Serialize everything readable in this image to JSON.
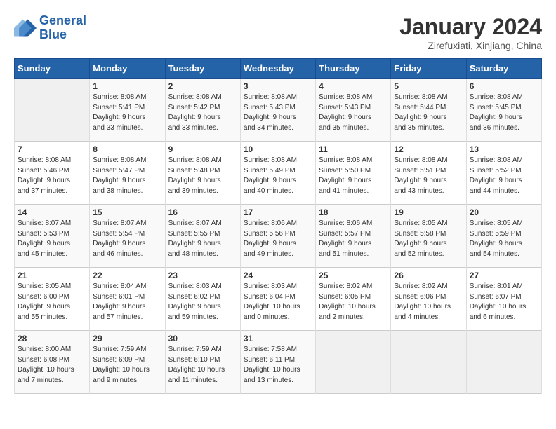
{
  "logo": {
    "line1": "General",
    "line2": "Blue"
  },
  "title": "January 2024",
  "location": "Zirefuxiati, Xinjiang, China",
  "days_header": [
    "Sunday",
    "Monday",
    "Tuesday",
    "Wednesday",
    "Thursday",
    "Friday",
    "Saturday"
  ],
  "weeks": [
    [
      {
        "day": "",
        "info": ""
      },
      {
        "day": "1",
        "info": "Sunrise: 8:08 AM\nSunset: 5:41 PM\nDaylight: 9 hours\nand 33 minutes."
      },
      {
        "day": "2",
        "info": "Sunrise: 8:08 AM\nSunset: 5:42 PM\nDaylight: 9 hours\nand 33 minutes."
      },
      {
        "day": "3",
        "info": "Sunrise: 8:08 AM\nSunset: 5:43 PM\nDaylight: 9 hours\nand 34 minutes."
      },
      {
        "day": "4",
        "info": "Sunrise: 8:08 AM\nSunset: 5:43 PM\nDaylight: 9 hours\nand 35 minutes."
      },
      {
        "day": "5",
        "info": "Sunrise: 8:08 AM\nSunset: 5:44 PM\nDaylight: 9 hours\nand 35 minutes."
      },
      {
        "day": "6",
        "info": "Sunrise: 8:08 AM\nSunset: 5:45 PM\nDaylight: 9 hours\nand 36 minutes."
      }
    ],
    [
      {
        "day": "7",
        "info": "Sunrise: 8:08 AM\nSunset: 5:46 PM\nDaylight: 9 hours\nand 37 minutes."
      },
      {
        "day": "8",
        "info": "Sunrise: 8:08 AM\nSunset: 5:47 PM\nDaylight: 9 hours\nand 38 minutes."
      },
      {
        "day": "9",
        "info": "Sunrise: 8:08 AM\nSunset: 5:48 PM\nDaylight: 9 hours\nand 39 minutes."
      },
      {
        "day": "10",
        "info": "Sunrise: 8:08 AM\nSunset: 5:49 PM\nDaylight: 9 hours\nand 40 minutes."
      },
      {
        "day": "11",
        "info": "Sunrise: 8:08 AM\nSunset: 5:50 PM\nDaylight: 9 hours\nand 41 minutes."
      },
      {
        "day": "12",
        "info": "Sunrise: 8:08 AM\nSunset: 5:51 PM\nDaylight: 9 hours\nand 43 minutes."
      },
      {
        "day": "13",
        "info": "Sunrise: 8:08 AM\nSunset: 5:52 PM\nDaylight: 9 hours\nand 44 minutes."
      }
    ],
    [
      {
        "day": "14",
        "info": "Sunrise: 8:07 AM\nSunset: 5:53 PM\nDaylight: 9 hours\nand 45 minutes."
      },
      {
        "day": "15",
        "info": "Sunrise: 8:07 AM\nSunset: 5:54 PM\nDaylight: 9 hours\nand 46 minutes."
      },
      {
        "day": "16",
        "info": "Sunrise: 8:07 AM\nSunset: 5:55 PM\nDaylight: 9 hours\nand 48 minutes."
      },
      {
        "day": "17",
        "info": "Sunrise: 8:06 AM\nSunset: 5:56 PM\nDaylight: 9 hours\nand 49 minutes."
      },
      {
        "day": "18",
        "info": "Sunrise: 8:06 AM\nSunset: 5:57 PM\nDaylight: 9 hours\nand 51 minutes."
      },
      {
        "day": "19",
        "info": "Sunrise: 8:05 AM\nSunset: 5:58 PM\nDaylight: 9 hours\nand 52 minutes."
      },
      {
        "day": "20",
        "info": "Sunrise: 8:05 AM\nSunset: 5:59 PM\nDaylight: 9 hours\nand 54 minutes."
      }
    ],
    [
      {
        "day": "21",
        "info": "Sunrise: 8:05 AM\nSunset: 6:00 PM\nDaylight: 9 hours\nand 55 minutes."
      },
      {
        "day": "22",
        "info": "Sunrise: 8:04 AM\nSunset: 6:01 PM\nDaylight: 9 hours\nand 57 minutes."
      },
      {
        "day": "23",
        "info": "Sunrise: 8:03 AM\nSunset: 6:02 PM\nDaylight: 9 hours\nand 59 minutes."
      },
      {
        "day": "24",
        "info": "Sunrise: 8:03 AM\nSunset: 6:04 PM\nDaylight: 10 hours\nand 0 minutes."
      },
      {
        "day": "25",
        "info": "Sunrise: 8:02 AM\nSunset: 6:05 PM\nDaylight: 10 hours\nand 2 minutes."
      },
      {
        "day": "26",
        "info": "Sunrise: 8:02 AM\nSunset: 6:06 PM\nDaylight: 10 hours\nand 4 minutes."
      },
      {
        "day": "27",
        "info": "Sunrise: 8:01 AM\nSunset: 6:07 PM\nDaylight: 10 hours\nand 6 minutes."
      }
    ],
    [
      {
        "day": "28",
        "info": "Sunrise: 8:00 AM\nSunset: 6:08 PM\nDaylight: 10 hours\nand 7 minutes."
      },
      {
        "day": "29",
        "info": "Sunrise: 7:59 AM\nSunset: 6:09 PM\nDaylight: 10 hours\nand 9 minutes."
      },
      {
        "day": "30",
        "info": "Sunrise: 7:59 AM\nSunset: 6:10 PM\nDaylight: 10 hours\nand 11 minutes."
      },
      {
        "day": "31",
        "info": "Sunrise: 7:58 AM\nSunset: 6:11 PM\nDaylight: 10 hours\nand 13 minutes."
      },
      {
        "day": "",
        "info": ""
      },
      {
        "day": "",
        "info": ""
      },
      {
        "day": "",
        "info": ""
      }
    ]
  ]
}
